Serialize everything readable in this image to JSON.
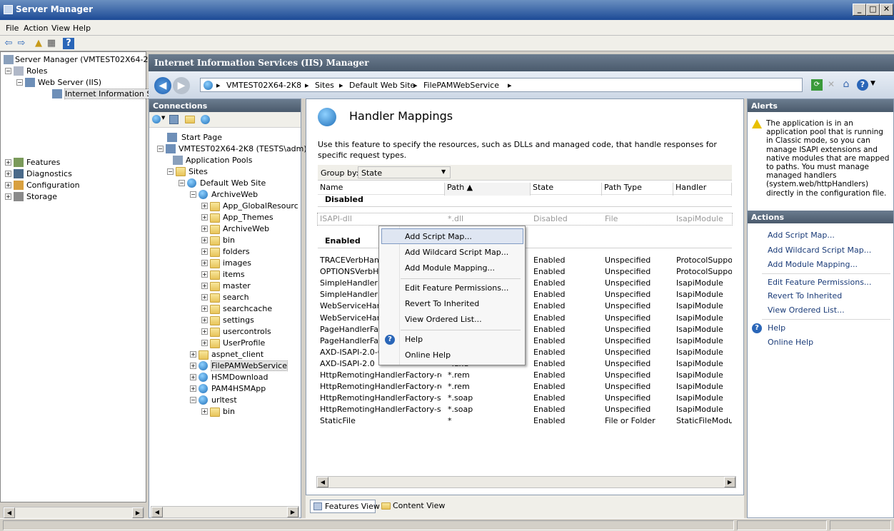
{
  "window": {
    "title": "Server Manager"
  },
  "menubar": {
    "file": "File",
    "action": "Action",
    "view": "View",
    "help": "Help"
  },
  "left_tree": {
    "root": "Server Manager (VMTEST02X64-2K",
    "roles": "Roles",
    "web_server": "Web Server (IIS)",
    "iis": "Internet Information Se",
    "features": "Features",
    "diagnostics": "Diagnostics",
    "configuration": "Configuration",
    "storage": "Storage"
  },
  "iis": {
    "title": "Internet Information Services (IIS) Manager"
  },
  "breadcrumb": [
    "VMTEST02X64-2K8",
    "Sites",
    "Default Web Site",
    "FilePAMWebService"
  ],
  "connections": {
    "title": "Connections",
    "items": {
      "start_page": "Start Page",
      "server": "VMTEST02X64-2K8 (TESTS\\adm)",
      "app_pools": "Application Pools",
      "sites": "Sites",
      "default_site": "Default Web Site",
      "archiveweb": "ArchiveWeb",
      "app_global": "App_GlobalResourc",
      "app_themes": "App_Themes",
      "archiveweb2": "ArchiveWeb",
      "bin": "bin",
      "folders": "folders",
      "images": "images",
      "items": "items",
      "master": "master",
      "search": "search",
      "searchcache": "searchcache",
      "settings": "settings",
      "usercontrols": "usercontrols",
      "userprofile": "UserProfile",
      "aspnet_client": "aspnet_client",
      "filepam": "FilePAMWebService",
      "hsmdownload": "HSMDownload",
      "pam4hsm": "PAM4HSMApp",
      "urltest": "urltest",
      "urltest_bin": "bin"
    }
  },
  "handler": {
    "title": "Handler Mappings",
    "description": "Use this feature to specify the resources, such as DLLs and managed code, that handle responses for specific request types.",
    "groupby_label": "Group by:",
    "groupby_value": "State",
    "columns": {
      "name": "Name",
      "path": "Path",
      "state": "State",
      "pathtype": "Path Type",
      "handler": "Handler"
    },
    "disabled_label": "Disabled",
    "enabled_label": "Enabled",
    "disabled_rows": [
      {
        "name": "ISAPI-dll",
        "path": "*.dll",
        "state": "Disabled",
        "pathtype": "File",
        "handler": "IsapiModule"
      }
    ],
    "enabled_rows": [
      {
        "name": "TRACEVerbHandl",
        "path": "",
        "state": "Enabled",
        "pathtype": "Unspecified",
        "handler": "ProtocolSupport"
      },
      {
        "name": "OPTIONSVerbHar",
        "path": "",
        "state": "Enabled",
        "pathtype": "Unspecified",
        "handler": "ProtocolSupport"
      },
      {
        "name": "SimpleHandlerFac",
        "path": "",
        "state": "Enabled",
        "pathtype": "Unspecified",
        "handler": "IsapiModule"
      },
      {
        "name": "SimpleHandlerFac",
        "path": "",
        "state": "Enabled",
        "pathtype": "Unspecified",
        "handler": "IsapiModule"
      },
      {
        "name": "WebServiceHandl",
        "path": "",
        "state": "Enabled",
        "pathtype": "Unspecified",
        "handler": "IsapiModule"
      },
      {
        "name": "WebServiceHandl",
        "path": "",
        "state": "Enabled",
        "pathtype": "Unspecified",
        "handler": "IsapiModule"
      },
      {
        "name": "PageHandlerFact",
        "path": "",
        "state": "Enabled",
        "pathtype": "Unspecified",
        "handler": "IsapiModule"
      },
      {
        "name": "PageHandlerFact",
        "path": "",
        "state": "Enabled",
        "pathtype": "Unspecified",
        "handler": "IsapiModule"
      },
      {
        "name": "AXD-ISAPI-2.0-64",
        "path": "",
        "state": "Enabled",
        "pathtype": "Unspecified",
        "handler": "IsapiModule"
      },
      {
        "name": "AXD-ISAPI-2.0",
        "path": "*.axd",
        "state": "Enabled",
        "pathtype": "Unspecified",
        "handler": "IsapiModule"
      },
      {
        "name": "HttpRemotingHandlerFactory-re...",
        "path": "*.rem",
        "state": "Enabled",
        "pathtype": "Unspecified",
        "handler": "IsapiModule"
      },
      {
        "name": "HttpRemotingHandlerFactory-re...",
        "path": "*.rem",
        "state": "Enabled",
        "pathtype": "Unspecified",
        "handler": "IsapiModule"
      },
      {
        "name": "HttpRemotingHandlerFactory-so...",
        "path": "*.soap",
        "state": "Enabled",
        "pathtype": "Unspecified",
        "handler": "IsapiModule"
      },
      {
        "name": "HttpRemotingHandlerFactory-so...",
        "path": "*.soap",
        "state": "Enabled",
        "pathtype": "Unspecified",
        "handler": "IsapiModule"
      },
      {
        "name": "StaticFile",
        "path": "*",
        "state": "Enabled",
        "pathtype": "File or Folder",
        "handler": "StaticFileModule"
      }
    ]
  },
  "context_menu": {
    "add_script_map": "Add Script Map...",
    "add_wildcard": "Add Wildcard Script Map...",
    "add_module": "Add Module Mapping...",
    "edit_perms": "Edit Feature Permissions...",
    "revert": "Revert To Inherited",
    "view_ordered": "View Ordered List...",
    "help": "Help",
    "online_help": "Online Help"
  },
  "view_tabs": {
    "features": "Features View",
    "content": "Content View"
  },
  "alerts": {
    "title": "Alerts",
    "message": "The application is in an application pool that is running in Classic mode, so you can manage ISAPI extensions and native modules that are mapped to paths. You must manage managed handlers (system.web/httpHandlers) directly in the configuration file."
  },
  "actions": {
    "title": "Actions",
    "add_script_map": "Add Script Map...",
    "add_wildcard": "Add Wildcard Script Map...",
    "add_module": "Add Module Mapping...",
    "edit_perms": "Edit Feature Permissions...",
    "revert": "Revert To Inherited",
    "view_ordered": "View Ordered List...",
    "help": "Help",
    "online_help": "Online Help"
  }
}
